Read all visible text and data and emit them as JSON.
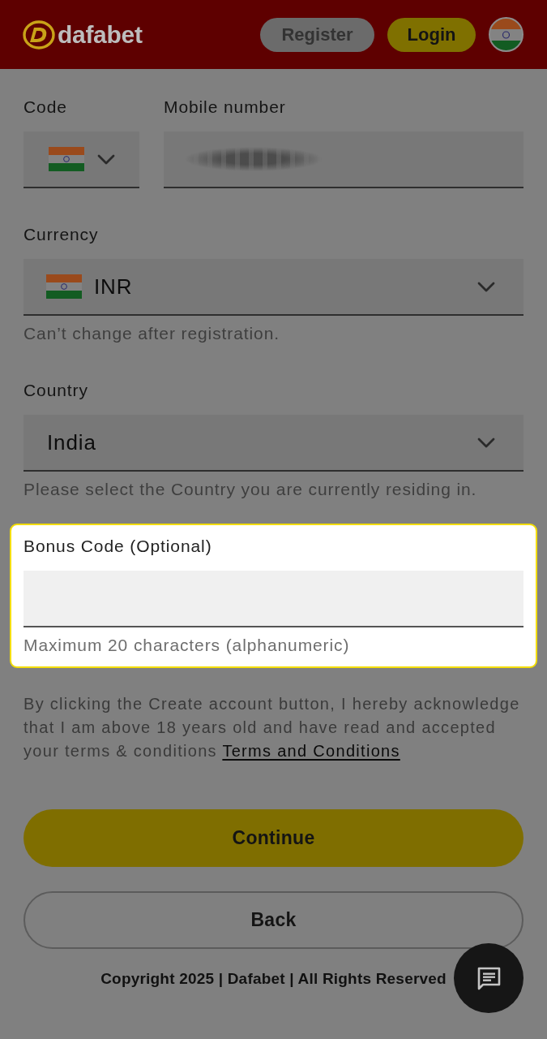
{
  "header": {
    "logo": "dafabet",
    "buttons": [
      {
        "kind": "register",
        "label": "Register"
      },
      {
        "kind": "login",
        "label": "Login"
      }
    ]
  },
  "fields": [
    {
      "kind": "phone",
      "code_label": "Code",
      "number_label": "Mobile number",
      "highlighted": false
    },
    {
      "kind": "select",
      "label": "Currency",
      "value": "INR",
      "flag": true,
      "note": "Can’t change after registration.",
      "highlighted": false
    },
    {
      "kind": "select",
      "label": "Country",
      "value": "India",
      "flag": false,
      "note": "Please select the Country you are currently residing in.",
      "highlighted": false
    },
    {
      "kind": "text",
      "label": "Bonus Code (Optional)",
      "note": "Maximum 20 characters (alphanumeric)",
      "highlighted": true
    }
  ],
  "consent": {
    "text": "By clicking the Create account button, I hereby acknowledge that I am above 18 years old and have read and accepted your terms & conditions",
    "link": "Terms and Conditions"
  },
  "actions": [
    {
      "kind": "primary",
      "label": "Continue"
    },
    {
      "kind": "secondary",
      "label": "Back"
    }
  ],
  "footer": {
    "copyright": "Copyright 2025 | Dafabet | All Rights Reserved"
  }
}
